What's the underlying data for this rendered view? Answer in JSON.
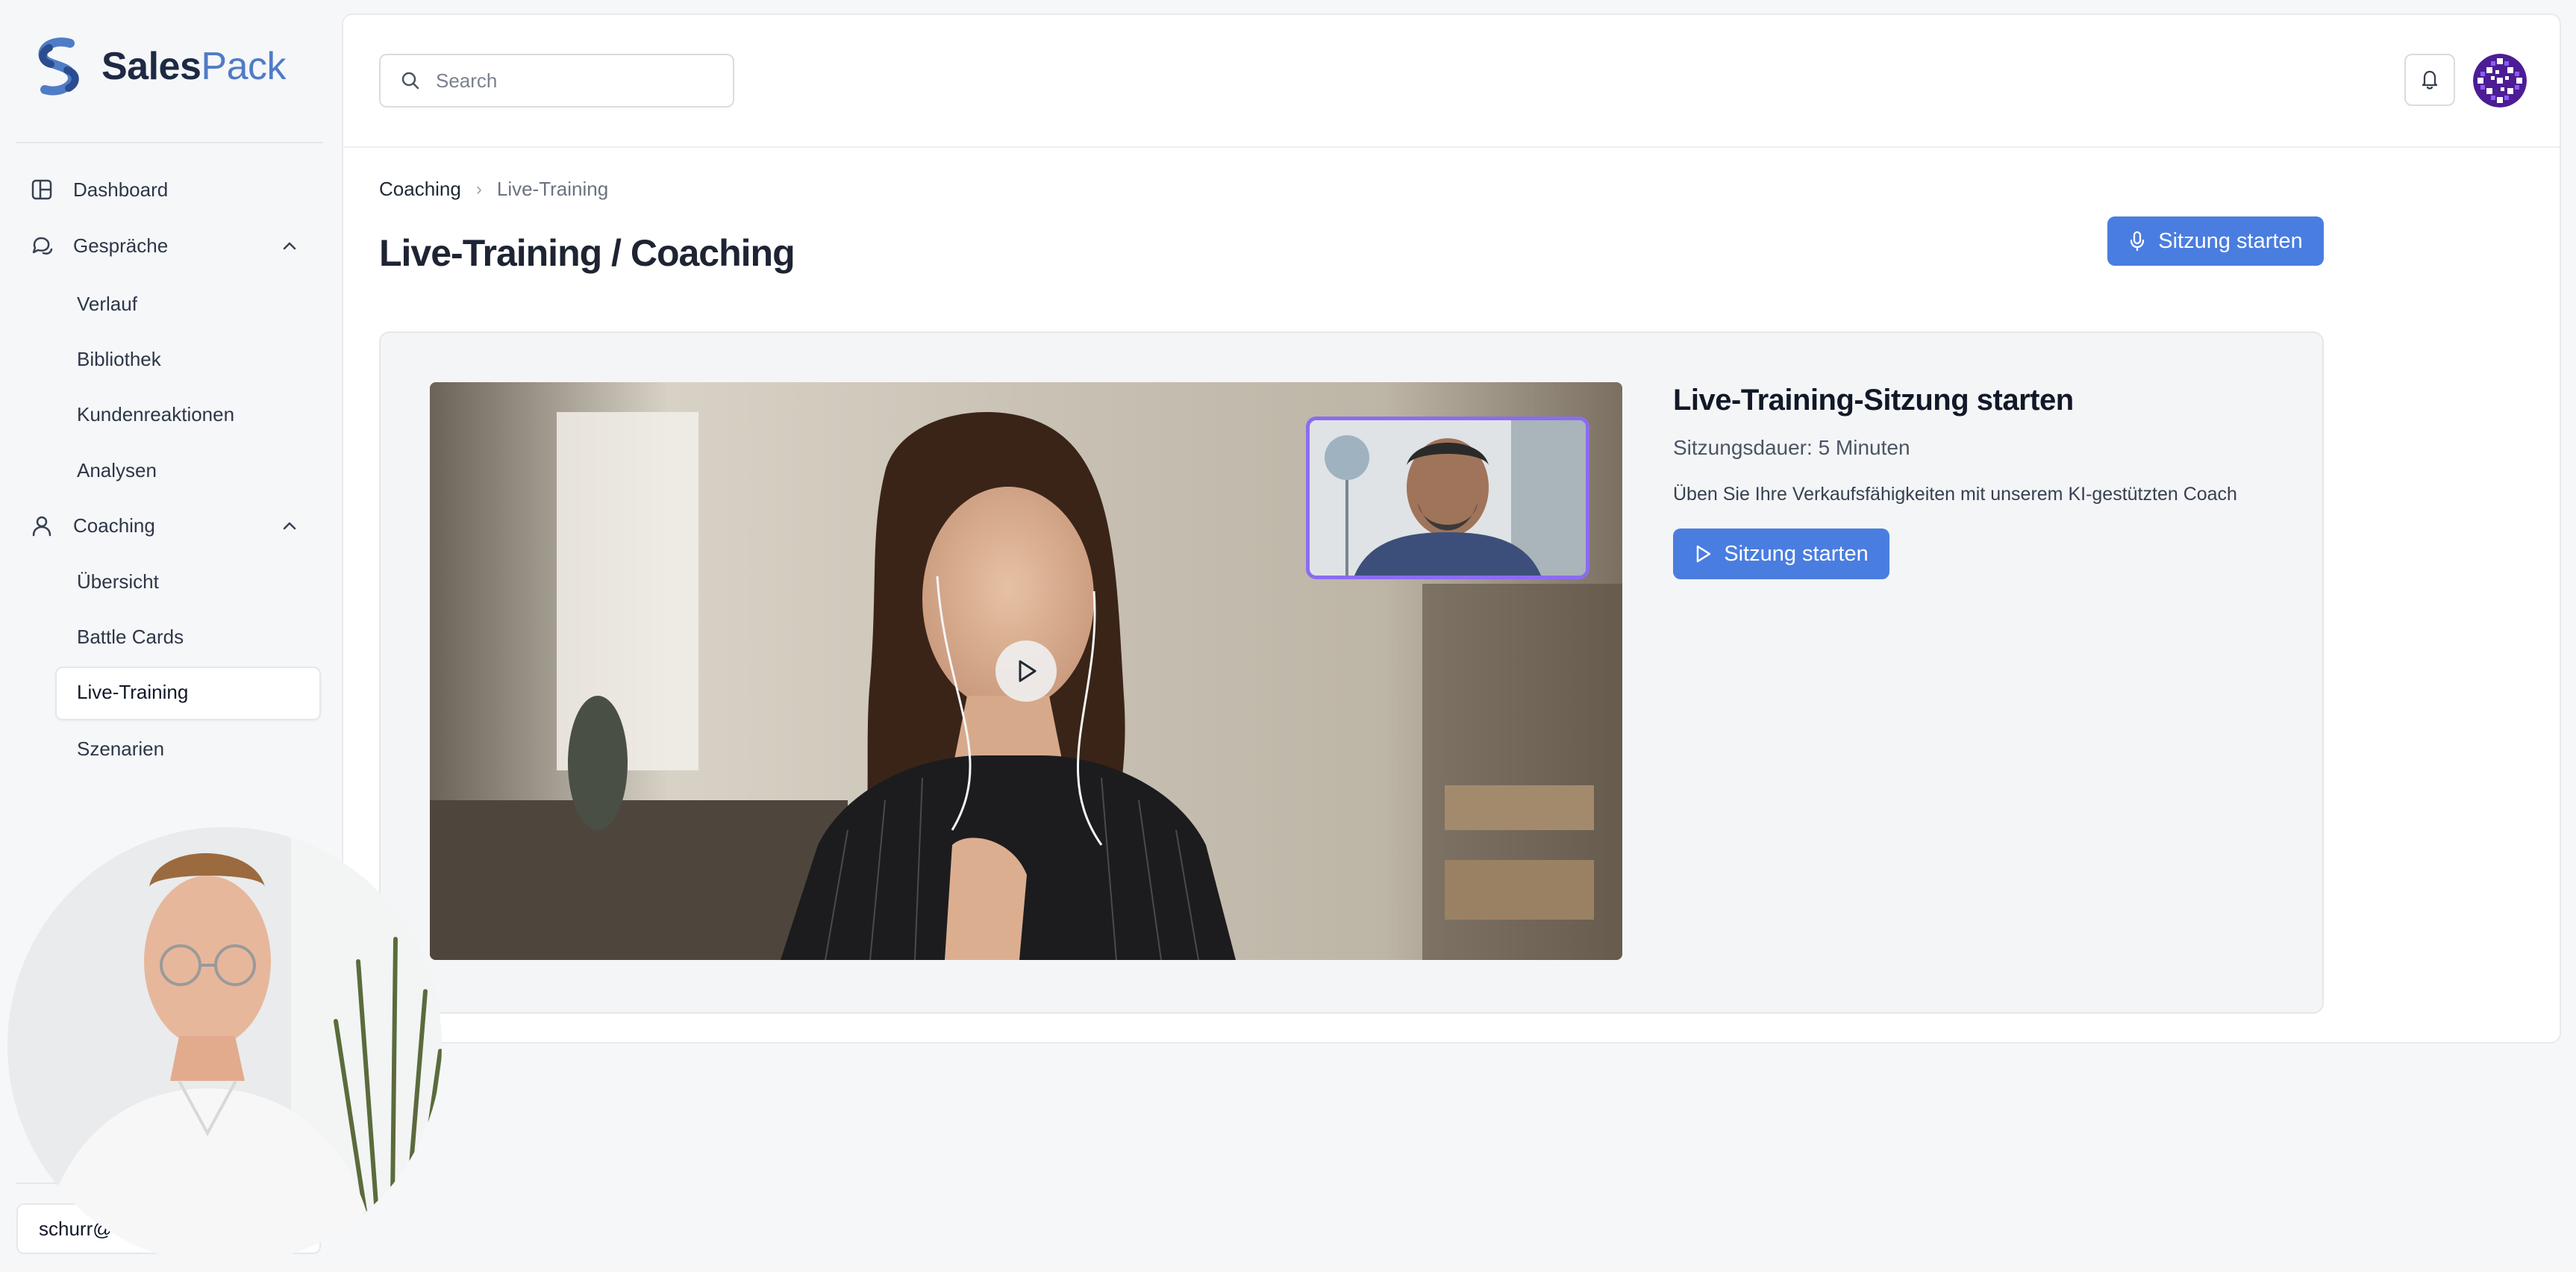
{
  "app": {
    "brand_main": "Sales",
    "brand_accent": "Pack",
    "accent_color": "#4a7de0"
  },
  "sidebar": {
    "items": [
      {
        "label": "Dashboard",
        "icon": "layout-icon"
      },
      {
        "label": "Gespräche",
        "icon": "chat-icon",
        "expanded": true,
        "children": [
          "Verlauf",
          "Bibliothek",
          "Kundenreaktionen",
          "Analysen"
        ]
      },
      {
        "label": "Coaching",
        "icon": "user-icon",
        "expanded": true,
        "children": [
          "Übersicht",
          "Battle Cards",
          "Live-Training",
          "Szenarien"
        ]
      }
    ],
    "active_item": "Live-Training",
    "user_label": "schurr@"
  },
  "topbar": {
    "search_placeholder": "Search"
  },
  "breadcrumb": {
    "parent": "Coaching",
    "current": "Live-Training"
  },
  "page": {
    "title": "Live-Training / Coaching",
    "header_button": "Sitzung starten"
  },
  "session": {
    "title": "Live-Training-Sitzung starten",
    "duration": "Sitzungsdauer: 5 Minuten",
    "description": "Üben Sie Ihre Verkaufsfähigkeiten mit unserem KI-gestützten Coach",
    "button": "Sitzung starten"
  }
}
